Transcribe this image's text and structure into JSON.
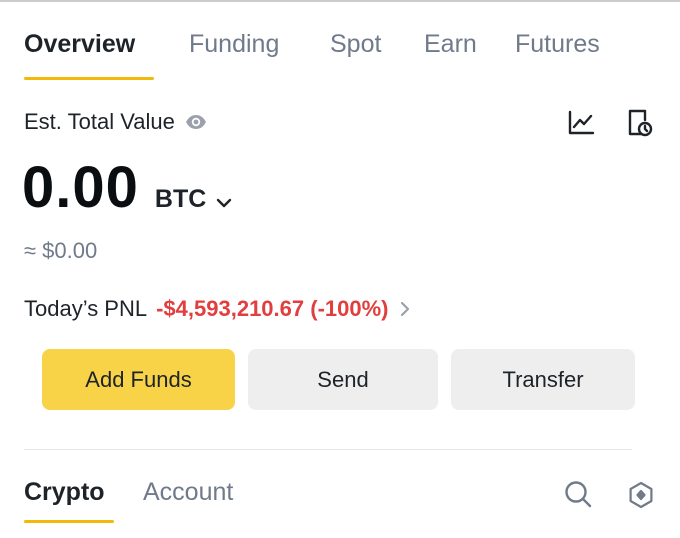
{
  "tabs": [
    {
      "label": "Overview",
      "active": true
    },
    {
      "label": "Funding"
    },
    {
      "label": "Spot"
    },
    {
      "label": "Earn"
    },
    {
      "label": "Futures"
    }
  ],
  "summary": {
    "est_label": "Est. Total Value",
    "balance": "0.00",
    "unit": "BTC",
    "fiat": "≈ $0.00",
    "pnl_label": "Today’s PNL",
    "pnl_value": "-$4,593,210.67 (-100%)"
  },
  "actions": {
    "add_funds": "Add Funds",
    "send": "Send",
    "transfer": "Transfer"
  },
  "bottom_tabs": [
    {
      "label": "Crypto",
      "active": true
    },
    {
      "label": "Account"
    }
  ],
  "icons": {
    "eye": "eye-icon",
    "chart": "line-chart-icon",
    "history": "document-clock-icon",
    "search": "search-icon",
    "settings": "hexagon-settings-icon"
  },
  "colors": {
    "accent": "#f0b90b",
    "primary_button": "#f8d347",
    "negative": "#e23e3e",
    "secondary_button": "#eeeeee"
  }
}
